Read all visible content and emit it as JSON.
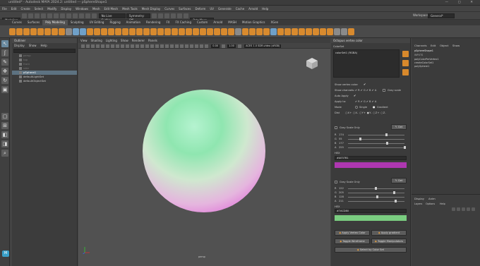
{
  "window": {
    "title": "untitled* - Autodesk MAYA 2024.2: untitled --- pSphereShape1",
    "controls": "—  ▢  ✕"
  },
  "menubar": [
    "File",
    "Edit",
    "Create",
    "Select",
    "Modify",
    "Display",
    "Windows",
    "Mesh",
    "Edit Mesh",
    "Mesh Tools",
    "Mesh Display",
    "Curves",
    "Surfaces",
    "Deform",
    "UV",
    "Generate",
    "Cache",
    "Arnold",
    "Help"
  ],
  "statusline": {
    "mode": "Modeling",
    "surface": "No Live Surface",
    "symmetry": "Symmetry: Off",
    "user": "Petr Masa",
    "workspace_label": "Workspace:",
    "workspace": "General*"
  },
  "shelf_tabs": [
    "Curves",
    "Surfaces",
    "Poly Modeling",
    "Sculpting",
    "UV Editing",
    "Rigging",
    "Animation",
    "Rendering",
    "FX",
    "FX Caching",
    "Custom",
    "Arnold",
    "MASH",
    "Motion Graphics",
    "XGen"
  ],
  "active_shelf_tab": "Poly Modeling",
  "outliner": {
    "title": "Outliner",
    "menu": [
      "Display",
      "Show",
      "Help"
    ],
    "items": [
      {
        "label": "persp",
        "dim": true
      },
      {
        "label": "top",
        "dim": true
      },
      {
        "label": "front",
        "dim": true
      },
      {
        "label": "side",
        "dim": true
      },
      {
        "label": "pSphere1",
        "dim": false,
        "selected": true
      },
      {
        "label": "defaultLightSet",
        "dim": false
      },
      {
        "label": "defaultObjectSet",
        "dim": false
      }
    ]
  },
  "viewport": {
    "menu": [
      "View",
      "Shading",
      "Lighting",
      "Show",
      "Renderer",
      "Panels"
    ],
    "fields": [
      "0.00",
      "1.00"
    ],
    "colorspace": "ACES 1.0 SDR-video (sRGB)",
    "camera": "persp"
  },
  "octopus": {
    "title": "Octopus vertex color",
    "colorset_label": "ColorSet",
    "colorset_value": "colorSet1 (RGBA)",
    "show_vertex_color": "Show vertex color:",
    "show_channels": "Show channels:",
    "channels": [
      "R",
      "G",
      "B",
      "A"
    ],
    "gray_scale": "Gray scale",
    "auto_apply": "Auto Apply",
    "apply_to": "Apply to:",
    "mode": "Mode",
    "mode_single": "Single",
    "mode_gradient": "Gradient",
    "dist": "Dist",
    "dist_axes": [
      "X+",
      "X-",
      "Y+",
      "Y-",
      "Z+",
      "Z-"
    ],
    "color1": {
      "gray_label": "Gray Scale Only",
      "get": "Get",
      "channels": [
        {
          "k": "R",
          "v": "174"
        },
        {
          "k": "G",
          "v": "55"
        },
        {
          "k": "B",
          "v": "177"
        },
        {
          "k": "A",
          "v": "255"
        }
      ],
      "hex_label": "HEX",
      "hex": "#AE37B1",
      "swatch": "#ae37b1"
    },
    "color2": {
      "gray_label": "Gray Scale Only",
      "get": "Get",
      "channels": [
        {
          "k": "R",
          "v": "122"
        },
        {
          "k": "G",
          "v": "205"
        },
        {
          "k": "B",
          "v": "128"
        },
        {
          "k": "A",
          "v": "211"
        }
      ],
      "hex_label": "HEX",
      "hex": "#7ACD80",
      "swatch": "#7acd80"
    },
    "buttons": {
      "apply_vertex": "Apply Vertex Color",
      "apply_gradient": "Apply gradient",
      "toggle_wire": "Toggle Wireframe",
      "toggle_manip": "Toggle Manipulators",
      "select_by_set": "Select by Color Set"
    }
  },
  "channelbox": {
    "tabs": [
      "Channels",
      "Edit",
      "Object",
      "Show"
    ],
    "node": "pSphereShape1",
    "inputs_label": "INPUTS",
    "inputs": [
      "polyColorPerVertex1",
      "createColorSet1",
      "polySphere1"
    ],
    "layer_tabs": [
      "Display",
      "Anim"
    ],
    "layer_menu": [
      "Layers",
      "Options",
      "Help"
    ]
  }
}
